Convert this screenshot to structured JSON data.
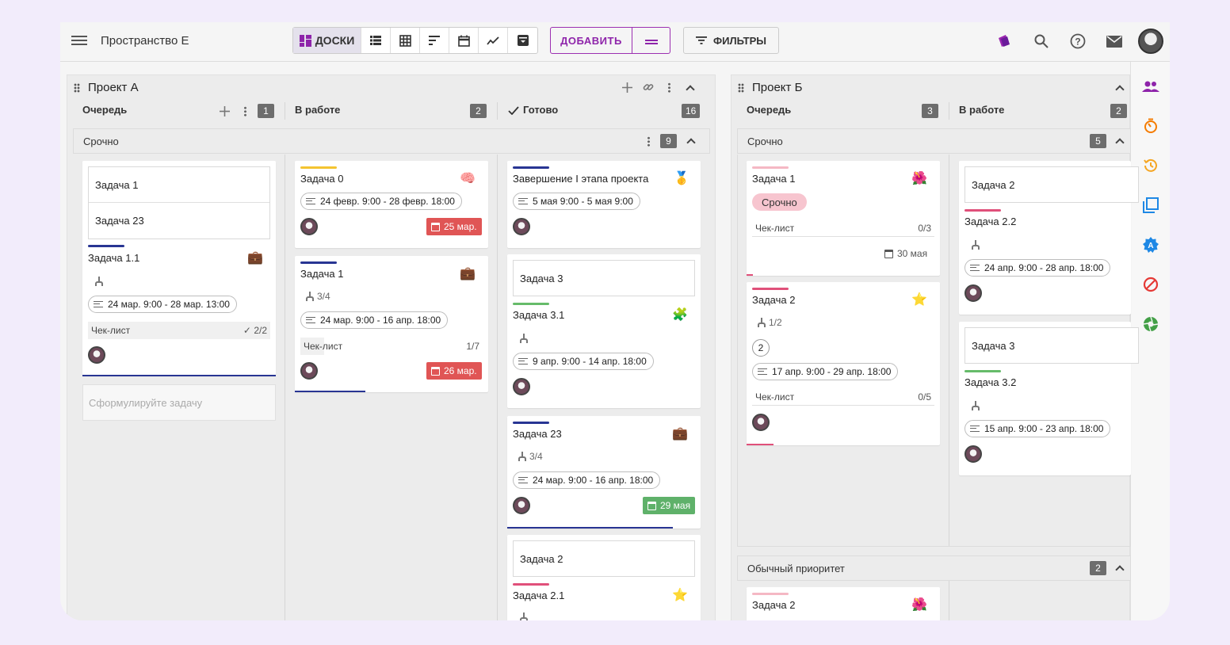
{
  "app": {
    "title": "Пространство Е"
  },
  "toolbar": {
    "boards_label": "ДОСКИ",
    "add_label": "ДОБАВИТЬ",
    "filters_label": "ФИЛЬТРЫ"
  },
  "projectA": {
    "title": "Проект А",
    "columns": [
      {
        "label": "Очередь",
        "count": "1"
      },
      {
        "label": "В работе",
        "count": "2"
      },
      {
        "label": "Готово",
        "count": "16"
      }
    ],
    "swimlane": {
      "label": "Срочно",
      "count": "9"
    },
    "queue": {
      "inner1": "Задача 1",
      "inner2": "Задача 23",
      "card_title": "Задача 1.1",
      "pill": "24 мар. 9:00 - 28 мар. 13:00",
      "check_label": "Чек-лист",
      "check_val": "2/2",
      "placeholder": "Сформулируйте задачу"
    },
    "inwork": [
      {
        "title": "Задача 0",
        "pill": "24 февр. 9:00 - 28 февр. 18:00",
        "due": "25 мар."
      },
      {
        "title": "Задача 1",
        "sub": "3/4",
        "pill": "24 мар. 9:00 - 16 апр. 18:00",
        "check_label": "Чек-лист",
        "check_val": "1/7",
        "due": "26 мар."
      }
    ],
    "done": [
      {
        "title": "Завершение I этапа проекта",
        "pill": "5 мая 9:00 - 5 мая 9:00"
      },
      {
        "inner": "Задача 3",
        "title": "Задача 3.1",
        "pill": "9 апр. 9:00 - 14 апр. 18:00"
      },
      {
        "title": "Задача 23",
        "sub": "3/4",
        "pill": "24 мар. 9:00 - 16 апр. 18:00",
        "due": "29 мая"
      },
      {
        "inner": "Задача 2",
        "title": "Задача 2.1"
      }
    ]
  },
  "projectB": {
    "title": "Проект Б",
    "columns": [
      {
        "label": "Очередь",
        "count": "3"
      },
      {
        "label": "В работе",
        "count": "2"
      }
    ],
    "swimlane": {
      "label": "Срочно",
      "count": "5"
    },
    "swimlane2": {
      "label": "Обычный приоритет",
      "count": "2"
    },
    "queue": [
      {
        "title": "Задача 1",
        "tag": "Срочно",
        "check_label": "Чек-лист",
        "check_val": "0/3",
        "due": "30 мая"
      },
      {
        "title": "Задача 2",
        "sub": "1/2",
        "num": "2",
        "pill": "17 апр. 9:00 - 29 апр. 18:00",
        "check_label": "Чек-лист",
        "check_val": "0/5"
      },
      {
        "title": "Задача 2"
      }
    ],
    "inwork": [
      {
        "inner": "Задача 2",
        "title": "Задача 2.2",
        "pill": "24 апр. 9:00 - 28 апр. 18:00"
      },
      {
        "inner": "Задача 3",
        "title": "Задача 3.2",
        "pill": "15 апр. 9:00 - 23 апр. 18:00"
      }
    ]
  },
  "colors": {
    "accent": "#8e24aa",
    "navy": "#283593",
    "yellow": "#f4c430",
    "pink": "#e0507a",
    "green": "#66bb6a",
    "lightpink": "#f5b8c4"
  }
}
